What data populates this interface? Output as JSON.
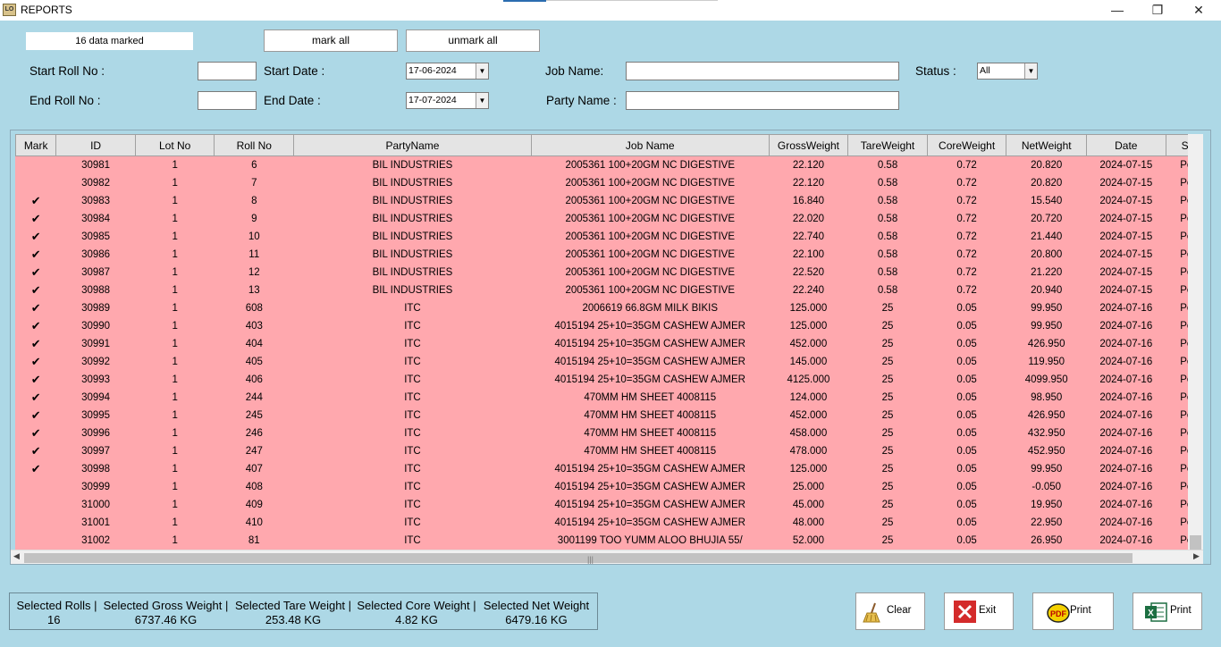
{
  "window": {
    "title": "REPORTS",
    "minimize": "—",
    "restore": "❐",
    "close": "✕"
  },
  "toolbar": {
    "marked_text": "16 data marked",
    "mark_all": "mark all",
    "unmark_all": "unmark all"
  },
  "filters": {
    "start_roll_label": "Start Roll No :",
    "end_roll_label": "End Roll No :",
    "start_date_label": "Start Date :",
    "end_date_label": "End Date :",
    "start_date_value": "17-06-2024",
    "end_date_value": "17-07-2024",
    "job_name_label": "Job Name:",
    "party_name_label": "Party Name :",
    "status_label": "Status :",
    "status_value": "All"
  },
  "grid": {
    "columns": [
      "Mark",
      "ID",
      "Lot No",
      "Roll No",
      "PartyName",
      "Job Name",
      "GrossWeight",
      "TareWeight",
      "CoreWeight",
      "NetWeight",
      "Date",
      "St"
    ],
    "rows": [
      [
        "",
        "30981",
        "1",
        "6",
        "BIL INDUSTRIES",
        "2005361 100+20GM NC DIGESTIVE",
        "22.120",
        "0.58",
        "0.72",
        "20.820",
        "2024-07-15",
        "Pe"
      ],
      [
        "",
        "30982",
        "1",
        "7",
        "BIL INDUSTRIES",
        "2005361 100+20GM NC DIGESTIVE",
        "22.120",
        "0.58",
        "0.72",
        "20.820",
        "2024-07-15",
        "Pe"
      ],
      [
        "✔",
        "30983",
        "1",
        "8",
        "BIL INDUSTRIES",
        "2005361 100+20GM NC DIGESTIVE",
        "16.840",
        "0.58",
        "0.72",
        "15.540",
        "2024-07-15",
        "Pe"
      ],
      [
        "✔",
        "30984",
        "1",
        "9",
        "BIL INDUSTRIES",
        "2005361 100+20GM NC DIGESTIVE",
        "22.020",
        "0.58",
        "0.72",
        "20.720",
        "2024-07-15",
        "Pe"
      ],
      [
        "✔",
        "30985",
        "1",
        "10",
        "BIL INDUSTRIES",
        "2005361 100+20GM NC DIGESTIVE",
        "22.740",
        "0.58",
        "0.72",
        "21.440",
        "2024-07-15",
        "Pe"
      ],
      [
        "✔",
        "30986",
        "1",
        "11",
        "BIL INDUSTRIES",
        "2005361 100+20GM NC DIGESTIVE",
        "22.100",
        "0.58",
        "0.72",
        "20.800",
        "2024-07-15",
        "Pe"
      ],
      [
        "✔",
        "30987",
        "1",
        "12",
        "BIL INDUSTRIES",
        "2005361 100+20GM NC DIGESTIVE",
        "22.520",
        "0.58",
        "0.72",
        "21.220",
        "2024-07-15",
        "Pe"
      ],
      [
        "✔",
        "30988",
        "1",
        "13",
        "BIL INDUSTRIES",
        "2005361 100+20GM NC DIGESTIVE",
        "22.240",
        "0.58",
        "0.72",
        "20.940",
        "2024-07-15",
        "Pe"
      ],
      [
        "✔",
        "30989",
        "1",
        "608",
        "ITC",
        "2006619 66.8GM MILK BIKIS",
        "125.000",
        "25",
        "0.05",
        "99.950",
        "2024-07-16",
        "Pe"
      ],
      [
        "✔",
        "30990",
        "1",
        "403",
        "ITC",
        "4015194 25+10=35GM CASHEW AJMER",
        "125.000",
        "25",
        "0.05",
        "99.950",
        "2024-07-16",
        "Pe"
      ],
      [
        "✔",
        "30991",
        "1",
        "404",
        "ITC",
        "4015194 25+10=35GM CASHEW AJMER",
        "452.000",
        "25",
        "0.05",
        "426.950",
        "2024-07-16",
        "Pe"
      ],
      [
        "✔",
        "30992",
        "1",
        "405",
        "ITC",
        "4015194 25+10=35GM CASHEW AJMER",
        "145.000",
        "25",
        "0.05",
        "119.950",
        "2024-07-16",
        "Pe"
      ],
      [
        "✔",
        "30993",
        "1",
        "406",
        "ITC",
        "4015194 25+10=35GM CASHEW AJMER",
        "4125.000",
        "25",
        "0.05",
        "4099.950",
        "2024-07-16",
        "Pe"
      ],
      [
        "✔",
        "30994",
        "1",
        "244",
        "ITC",
        "470MM HM SHEET 4008115",
        "124.000",
        "25",
        "0.05",
        "98.950",
        "2024-07-16",
        "Pe"
      ],
      [
        "✔",
        "30995",
        "1",
        "245",
        "ITC",
        "470MM HM SHEET 4008115",
        "452.000",
        "25",
        "0.05",
        "426.950",
        "2024-07-16",
        "Pe"
      ],
      [
        "✔",
        "30996",
        "1",
        "246",
        "ITC",
        "470MM HM SHEET 4008115",
        "458.000",
        "25",
        "0.05",
        "432.950",
        "2024-07-16",
        "Pe"
      ],
      [
        "✔",
        "30997",
        "1",
        "247",
        "ITC",
        "470MM HM SHEET 4008115",
        "478.000",
        "25",
        "0.05",
        "452.950",
        "2024-07-16",
        "Pe"
      ],
      [
        "✔",
        "30998",
        "1",
        "407",
        "ITC",
        "4015194 25+10=35GM CASHEW AJMER",
        "125.000",
        "25",
        "0.05",
        "99.950",
        "2024-07-16",
        "Pe"
      ],
      [
        "",
        "30999",
        "1",
        "408",
        "ITC",
        "4015194 25+10=35GM CASHEW AJMER",
        "25.000",
        "25",
        "0.05",
        "-0.050",
        "2024-07-16",
        "Pe"
      ],
      [
        "",
        "31000",
        "1",
        "409",
        "ITC",
        "4015194 25+10=35GM CASHEW AJMER",
        "45.000",
        "25",
        "0.05",
        "19.950",
        "2024-07-16",
        "Pe"
      ],
      [
        "",
        "31001",
        "1",
        "410",
        "ITC",
        "4015194 25+10=35GM CASHEW AJMER",
        "48.000",
        "25",
        "0.05",
        "22.950",
        "2024-07-16",
        "Pe"
      ],
      [
        "",
        "31002",
        "1",
        "81",
        "ITC",
        "3001199 TOO YUMM ALOO BHUJIA 55/",
        "52.000",
        "25",
        "0.05",
        "26.950",
        "2024-07-16",
        "Pe"
      ]
    ]
  },
  "summary": {
    "rolls_label": "Selected Rolls |",
    "rolls_value": "16",
    "gross_label": "Selected Gross Weight |",
    "gross_value": "6737.46 KG",
    "tare_label": "Selected Tare Weight |",
    "tare_value": "253.48 KG",
    "core_label": "Selected Core Weight |",
    "core_value": "4.82 KG",
    "net_label": "Selected Net Weight",
    "net_value": "6479.16 KG"
  },
  "actions": {
    "clear": "Clear",
    "exit": "Exit",
    "print_pdf": "Print",
    "print_excel": "Print"
  },
  "icons": {
    "app": "app-logo-icon",
    "clear": "broom-icon",
    "exit": "red-x-icon",
    "pdf": "pdf-icon",
    "excel": "excel-icon"
  },
  "colors": {
    "background": "#add8e6",
    "row": "#ffa8ae",
    "header": "#e4e4e4"
  }
}
